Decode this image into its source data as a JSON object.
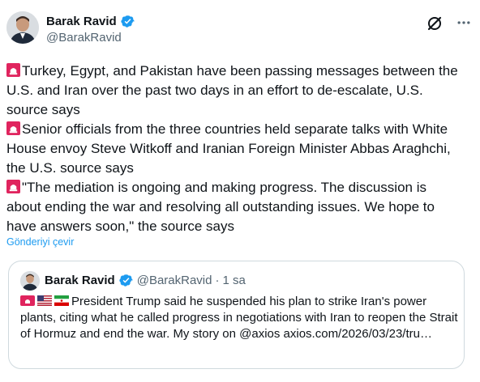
{
  "author": {
    "display_name": "Barak Ravid",
    "handle": "@BarakRavid"
  },
  "tweet": {
    "paragraphs": [
      "Turkey, Egypt, and Pakistan have been passing messages between the U.S. and Iran over the past two days in an effort to de-escalate, U.S. source says",
      "Senior officials from the three countries held separate talks with White House envoy Steve Witkoff and Iranian Foreign Minister Abbas Araghchi, the U.S. source says",
      "\"The mediation is ongoing and making progress. The discussion is about ending the war and resolving all outstanding issues. We hope to have answers soon,\" the source says"
    ],
    "translate_label": "Gönderiyi çevir"
  },
  "quote": {
    "display_name": "Barak Ravid",
    "handle": "@BarakRavid",
    "separator": "·",
    "time": "1 sa",
    "text": "President Trump said he suspended his plan to strike Iran's power plants, citing what he called progress in negotiations with Iran to reopen the Strait of Hormuz and end the war. My story on @axios axios.com/2026/03/23/tru…"
  },
  "icons": {
    "paragraph_marker": "siren-emoji",
    "quote_flags": [
      "siren-emoji",
      "us-flag-emoji",
      "iran-flag-emoji"
    ],
    "verified": "verified-badge-icon",
    "grok": "grok-icon",
    "more": "more-icon"
  },
  "colors": {
    "verified_blue": "#1d9bf0",
    "link_blue": "#1d9bf0",
    "secondary_text": "#536471",
    "border": "#cfd9de",
    "siren_red": "#e0245e"
  }
}
